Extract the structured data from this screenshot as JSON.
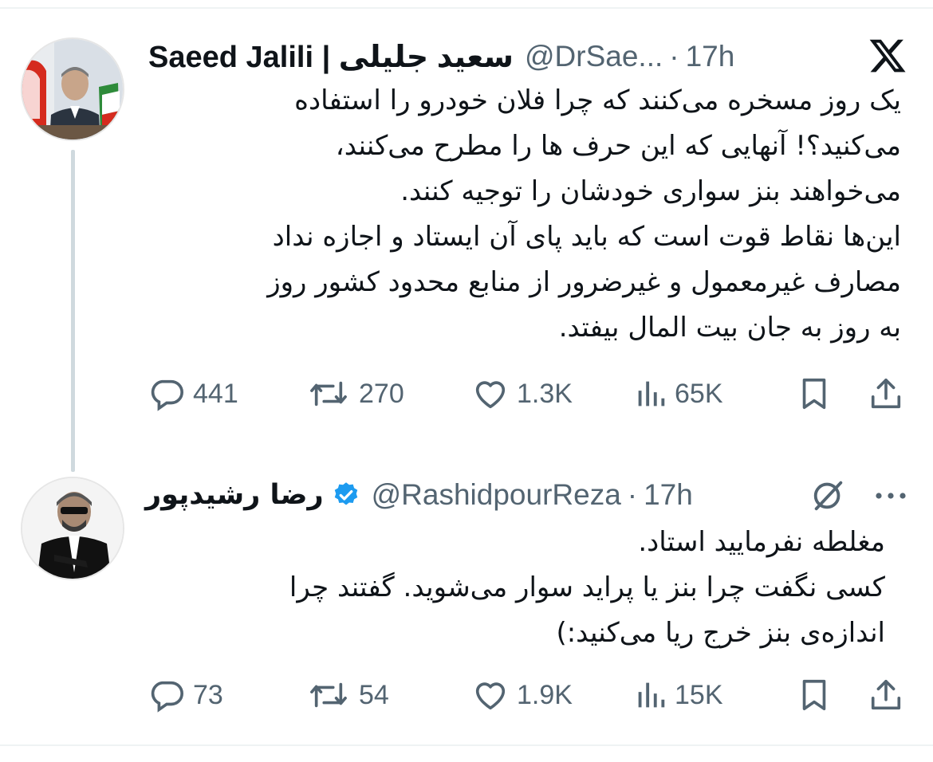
{
  "app": {
    "logo_icon": "x-logo-icon"
  },
  "tweets": [
    {
      "name": "Saeed Jalili | سعید جلیلی",
      "handle": "@DrSae...",
      "time": "17h",
      "text_lines": [
        "یک روز مسخره می‌کنند که چرا فلان خودرو را استفاده",
        "می‌کنید؟! آنهایی که این حرف ها را مطرح می‌کنند،",
        "می‌خواهند بنز سواری خودشان را توجیه کنند.",
        "این‌ها نقاط قوت است که باید پای آن ایستاد و اجازه نداد",
        "مصارف غیرمعمول و غیرضرور از منابع محدود کشور روز",
        "به روز به جان بیت المال بیفتد."
      ],
      "stats": {
        "replies": "441",
        "reposts": "270",
        "likes": "1.3K",
        "views": "65K"
      }
    },
    {
      "name": "رضا رشیدپور",
      "verified": true,
      "handle": "@RashidpourReza",
      "time": "17h",
      "text_lines": [
        "مغلطه نفرمایید استاد.",
        "کسی نگفت چرا بنز یا پراید سوار می‌شوید. گفتند چرا",
        "اندازه‌ی بنز خرج ریا می‌کنید:)"
      ],
      "stats": {
        "replies": "73",
        "reposts": "54",
        "likes": "1.9K",
        "views": "15K"
      }
    }
  ],
  "colors": {
    "text": "#0f1419",
    "secondary": "#536471",
    "verified": "#1d9bf0",
    "thread_line": "#cfd9de"
  }
}
